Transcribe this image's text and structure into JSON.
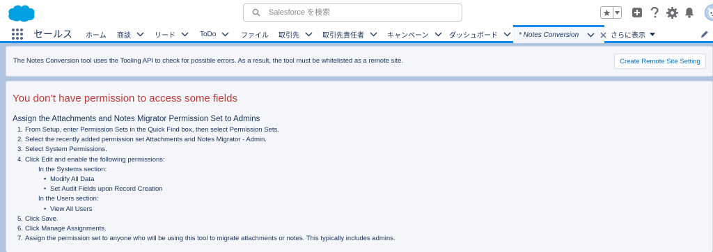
{
  "header": {
    "search_placeholder": "Salesforce を検索"
  },
  "nav": {
    "app_name": "セールス",
    "items": [
      {
        "label": "ホーム"
      },
      {
        "label": "商談"
      },
      {
        "label": "リード"
      },
      {
        "label": "ToDo"
      },
      {
        "label": "ファイル"
      },
      {
        "label": "取引先"
      },
      {
        "label": "取引先責任者"
      },
      {
        "label": "キャンペーン"
      },
      {
        "label": "ダッシュボード"
      }
    ],
    "active_tab": "* Notes Conversion",
    "more": "さらに表示"
  },
  "banner": {
    "message": "The Notes Conversion tool uses the Tooling API to check for possible errors. As a result, the tool must be whitelisted as a remote site.",
    "button": "Create Remote Site Setting"
  },
  "permissions": {
    "error_title": "You don’t have permission to access some fields",
    "subtitle": "Assign the Attachments and Notes Migrator Permission Set to Admins",
    "lines": [
      {
        "n": "1.",
        "t": "From Setup, enter Permission Sets in the Quick Find box, then select Permission Sets."
      },
      {
        "n": "2.",
        "t": "Select the recently added permission set Attachments and Notes Migrator - Admin."
      },
      {
        "n": "3.",
        "t": "Select System Permissions."
      },
      {
        "n": "4.",
        "t": "Click Edit and enable the following permissions:"
      },
      {
        "t": "In the Systems section:"
      },
      {
        "t": "Modify All Data"
      },
      {
        "t": "Set Audit Fields upon Record Creation"
      },
      {
        "t": "In the Users section:"
      },
      {
        "t": "View All Users"
      },
      {
        "n": "5.",
        "t": "Click Save."
      },
      {
        "n": "6.",
        "t": "Click Manage Assignments."
      },
      {
        "n": "7.",
        "t": "Assign the permission set to anyone who will be using this tool to migrate attachments or notes. This typically includes admins."
      }
    ]
  },
  "colors": {
    "brand": "#00a1e0",
    "accent": "#1589ee",
    "error": "#c23934",
    "link": "#0070d2"
  }
}
